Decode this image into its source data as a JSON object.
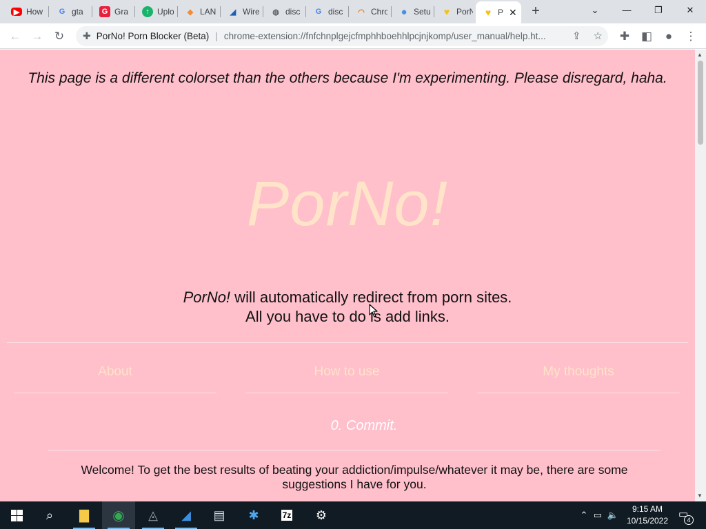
{
  "browser": {
    "tabs": [
      {
        "title": "How",
        "icon": "youtube-icon",
        "glyph": "▶",
        "color": "#ff0000",
        "fg": "#ffffff"
      },
      {
        "title": "gta",
        "icon": "google-icon",
        "glyph": "G",
        "color": "#ffffff",
        "fg": "#4285f4"
      },
      {
        "title": "Gra",
        "icon": "grammarly-icon",
        "glyph": "G",
        "color": "#e8203c",
        "fg": "#ffffff"
      },
      {
        "title": "Uplo",
        "icon": "upload-icon",
        "glyph": "↑",
        "color": "#19b36b",
        "fg": "#ffffff"
      },
      {
        "title": "LAN",
        "icon": "lan-icon",
        "glyph": "◆",
        "color": "#ffffff",
        "fg": "#f28c38"
      },
      {
        "title": "Wire",
        "icon": "wireshark-icon",
        "glyph": "◢",
        "color": "#ffffff",
        "fg": "#1a5fb4"
      },
      {
        "title": "disc",
        "icon": "globe-icon",
        "glyph": "◍",
        "color": "#ffffff",
        "fg": "#5f6368"
      },
      {
        "title": "disc",
        "icon": "google-icon",
        "glyph": "G",
        "color": "#ffffff",
        "fg": "#4285f4"
      },
      {
        "title": "Chro",
        "icon": "chrome-rainbow-icon",
        "glyph": "◠",
        "color": "#ffffff",
        "fg": "#e8710a"
      },
      {
        "title": "Setu",
        "icon": "circle-blue-icon",
        "glyph": "●",
        "color": "#ffffff",
        "fg": "#4a90e2"
      },
      {
        "title": "PorN",
        "icon": "heart-icon",
        "glyph": "♥",
        "color": "#ffffff",
        "fg": "#f4c20d"
      },
      {
        "title": "P",
        "icon": "heart-icon",
        "glyph": "♥",
        "color": "#ffffff",
        "fg": "#f4c20d"
      }
    ],
    "omnibox": {
      "site_name": "PorNo! Porn Blocker (Beta)",
      "url": "chrome-extension://fnfchnplgejcfmphhboehhlpcjnjkomp/user_manual/help.ht..."
    }
  },
  "page": {
    "notice": "This page is a different colorset than the others because I'm experimenting. Please disregard, haha.",
    "logo": "PorNo!",
    "tagline_brand": "PorNo!",
    "tagline_rest": " will automatically redirect from porn sites.",
    "tagline_line2": "All you have to do is add links.",
    "nav": [
      "About",
      "How to use",
      "My thoughts"
    ],
    "section_title": "0. Commit.",
    "welcome": "Welcome! To get the best results of beating your addiction/impulse/whatever it may be, there are some suggestions I have for you."
  },
  "taskbar": {
    "time": "9:15 AM",
    "date": "10/15/2022",
    "notification_count": "4"
  },
  "colors": {
    "page_background": "#ffbfcb",
    "logo": "#ffe4c9",
    "nav_links": "#ffe4c9",
    "section_title": "#ffffff"
  }
}
